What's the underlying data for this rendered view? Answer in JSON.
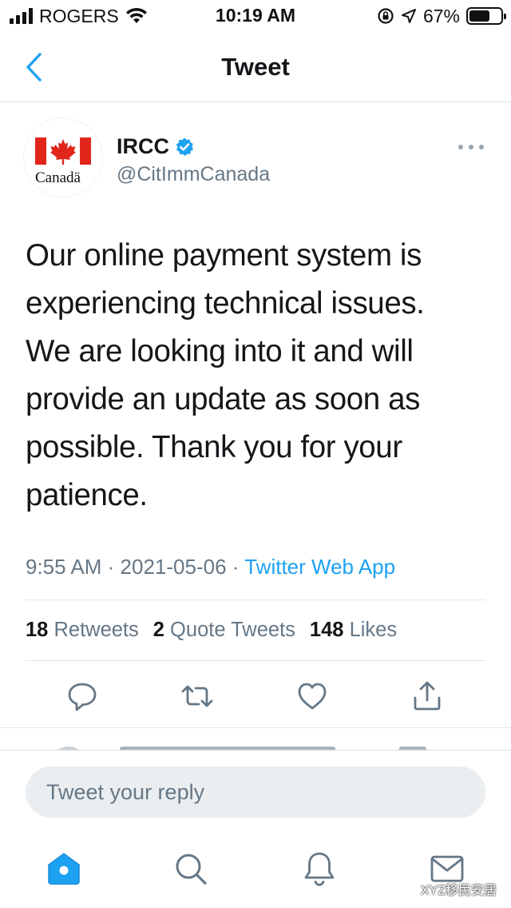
{
  "status_bar": {
    "carrier": "ROGERS",
    "time": "10:19 AM",
    "battery_percent": "67%",
    "battery_level": 0.67,
    "icons": [
      "signal-icon",
      "wifi-icon",
      "rotation-lock-icon",
      "location-arrow-icon",
      "battery-icon"
    ]
  },
  "header": {
    "title": "Tweet",
    "back_icon": "chevron-left-icon"
  },
  "tweet": {
    "avatar": {
      "brand_text": "Canadä",
      "flag_red": "#e1251b"
    },
    "display_name": "IRCC",
    "verified_icon": "verified-badge-icon",
    "handle": "@CitImmCanada",
    "more_icon": "more-horizontal-icon",
    "text": "Our online payment system is experiencing technical issues. We are looking into it and will provide an update as soon as possible. Thank you for your patience.",
    "time": "9:55 AM",
    "date": "2021-05-06",
    "separator": "·",
    "source": "Twitter Web App",
    "stats": {
      "retweets_count": "18",
      "retweets_label": "Retweets",
      "quotes_count": "2",
      "quotes_label": "Quote Tweets",
      "likes_count": "148",
      "likes_label": "Likes"
    },
    "actions": [
      "reply-icon",
      "retweet-icon",
      "like-icon",
      "share-icon"
    ]
  },
  "reply": {
    "placeholder": "Tweet your reply"
  },
  "tab_bar": {
    "items": [
      "home-icon",
      "search-icon",
      "notifications-icon",
      "messages-icon"
    ]
  },
  "watermark": {
    "text": "XYZ移民安居"
  },
  "colors": {
    "accent": "#1da1f2",
    "text_primary": "#14171a",
    "text_secondary": "#657786",
    "verified": "#1da1f2"
  }
}
